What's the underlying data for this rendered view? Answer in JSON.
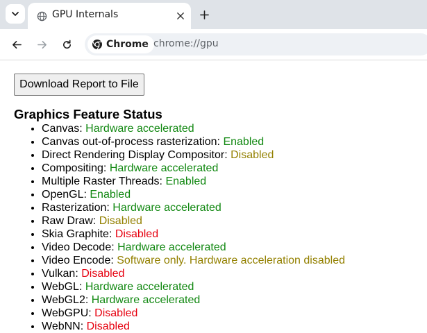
{
  "browser": {
    "tab_title": "GPU Internals",
    "chip_label": "Chrome",
    "url": "chrome://gpu"
  },
  "page": {
    "download_button": "Download Report to File",
    "section_title": "Graphics Feature Status",
    "features": [
      {
        "name": "Canvas: ",
        "status": "Hardware accelerated",
        "level": "green"
      },
      {
        "name": "Canvas out-of-process rasterization: ",
        "status": "Enabled",
        "level": "green"
      },
      {
        "name": "Direct Rendering Display Compositor: ",
        "status": "Disabled",
        "level": "olive"
      },
      {
        "name": "Compositing: ",
        "status": "Hardware accelerated",
        "level": "green"
      },
      {
        "name": "Multiple Raster Threads: ",
        "status": "Enabled",
        "level": "green"
      },
      {
        "name": "OpenGL: ",
        "status": "Enabled",
        "level": "green"
      },
      {
        "name": "Rasterization: ",
        "status": "Hardware accelerated",
        "level": "green"
      },
      {
        "name": "Raw Draw: ",
        "status": "Disabled",
        "level": "olive"
      },
      {
        "name": "Skia Graphite: ",
        "status": "Disabled",
        "level": "red"
      },
      {
        "name": "Video Decode: ",
        "status": "Hardware accelerated",
        "level": "green"
      },
      {
        "name": "Video Encode: ",
        "status": "Software only. Hardware acceleration disabled",
        "level": "olive"
      },
      {
        "name": "Vulkan: ",
        "status": "Disabled",
        "level": "red"
      },
      {
        "name": "WebGL: ",
        "status": "Hardware accelerated",
        "level": "green"
      },
      {
        "name": "WebGL2: ",
        "status": "Hardware accelerated",
        "level": "green"
      },
      {
        "name": "WebGPU: ",
        "status": "Disabled",
        "level": "red"
      },
      {
        "name": "WebNN: ",
        "status": "Disabled",
        "level": "red"
      }
    ]
  },
  "colors": {
    "green": "#118811",
    "olive": "#938000",
    "red": "#e6000f"
  },
  "icons": [
    "chevron-down-icon",
    "globe-icon",
    "close-icon",
    "plus-icon",
    "back-arrow-icon",
    "forward-arrow-icon",
    "reload-icon",
    "chrome-logo-icon"
  ]
}
